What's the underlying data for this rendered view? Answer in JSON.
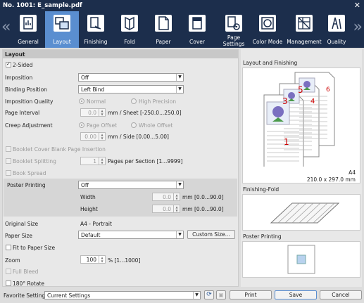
{
  "window": {
    "title": "No. 1001: E_sample.pdf",
    "close": "✕"
  },
  "nav": {
    "prev": "«",
    "next": "»"
  },
  "tabs": [
    {
      "label": "General",
      "icon": "general-icon"
    },
    {
      "label": "Layout",
      "icon": "layout-icon",
      "active": true
    },
    {
      "label": "Finishing",
      "icon": "finishing-icon"
    },
    {
      "label": "Fold",
      "icon": "fold-icon"
    },
    {
      "label": "Paper",
      "icon": "paper-icon"
    },
    {
      "label": "Cover",
      "icon": "cover-icon"
    },
    {
      "label": "Page\nSettings",
      "icon": "page-settings-icon"
    },
    {
      "label": "Color Mode",
      "icon": "color-mode-icon"
    },
    {
      "label": "Management",
      "icon": "management-icon"
    },
    {
      "label": "Quality",
      "icon": "quality-icon"
    }
  ],
  "layout": {
    "section_title": "Layout",
    "two_sided": "2-Sided",
    "imposition": {
      "label": "Imposition",
      "value": "Off"
    },
    "binding": {
      "label": "Binding Position",
      "value": "Left Bind"
    },
    "quality": {
      "label": "Imposition Quality",
      "normal": "Normal",
      "high": "High Precision"
    },
    "interval": {
      "label": "Page Interval",
      "value": "0.0",
      "unit": "mm / Sheet [-250.0...250.0]"
    },
    "creep": {
      "label": "Creep Adjustment",
      "offset": "Page Offset",
      "whole": "Whole Offset",
      "value": "0.00",
      "unit": "mm / Side [0.00...5.00]"
    },
    "booklet_cover": "Booklet Cover Blank Page Insertion",
    "booklet_split": {
      "label": "Booklet Splitting",
      "value": "1",
      "unit": "Pages per Section [1...9999]"
    },
    "book_spread": "Book Spread",
    "poster": {
      "label": "Poster Printing",
      "value": "Off",
      "width_label": "Width",
      "width": "0.0",
      "height_label": "Height",
      "height": "0.0",
      "unit": "mm [0.0...90.0]"
    },
    "original_size": {
      "label": "Original Size",
      "value": "A4 - Portrait"
    },
    "paper_size": {
      "label": "Paper Size",
      "value": "Default",
      "button": "Custom Size..."
    },
    "fit": "Fit to Paper Size",
    "zoom": {
      "label": "Zoom",
      "value": "100",
      "unit": "% [1...1000]"
    },
    "full_bleed": "Full Bleed",
    "rotate": "180° Rotate"
  },
  "preview": {
    "finishing_title": "Layout and Finishing",
    "page_numbers": [
      "1",
      "3",
      "4",
      "5",
      "6"
    ],
    "paper": "A4",
    "dims": "210.0 x 297.0 mm",
    "fold_title": "Finishing-Fold",
    "poster_title": "Poster Printing"
  },
  "footer": {
    "favorite_label": "Favorite Setting",
    "favorite_value": "Current Settings",
    "print": "Print",
    "save": "Save",
    "cancel": "Cancel"
  }
}
